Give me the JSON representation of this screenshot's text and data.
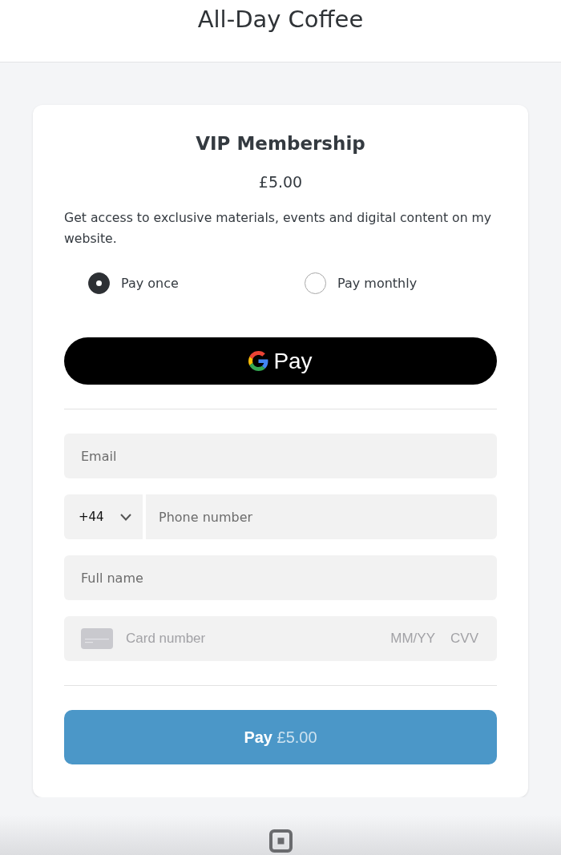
{
  "header": {
    "title": "All-Day Coffee"
  },
  "product": {
    "name": "VIP Membership",
    "price": "£5.00",
    "description": "Get access to exclusive materials, events and digital content on my website."
  },
  "payment_options": [
    {
      "label": "Pay once",
      "selected": true
    },
    {
      "label": "Pay monthly",
      "selected": false
    }
  ],
  "google_pay_button": {
    "label": "Pay"
  },
  "form": {
    "email": {
      "placeholder": "Email"
    },
    "phone": {
      "country_code": "+44",
      "placeholder": "Phone number"
    },
    "full_name": {
      "placeholder": "Full name"
    },
    "card": {
      "number_placeholder": "Card number",
      "expiry_placeholder": "MM/YY",
      "cvv_placeholder": "CVV"
    }
  },
  "pay_button": {
    "label": "**Pay** £5.00"
  }
}
